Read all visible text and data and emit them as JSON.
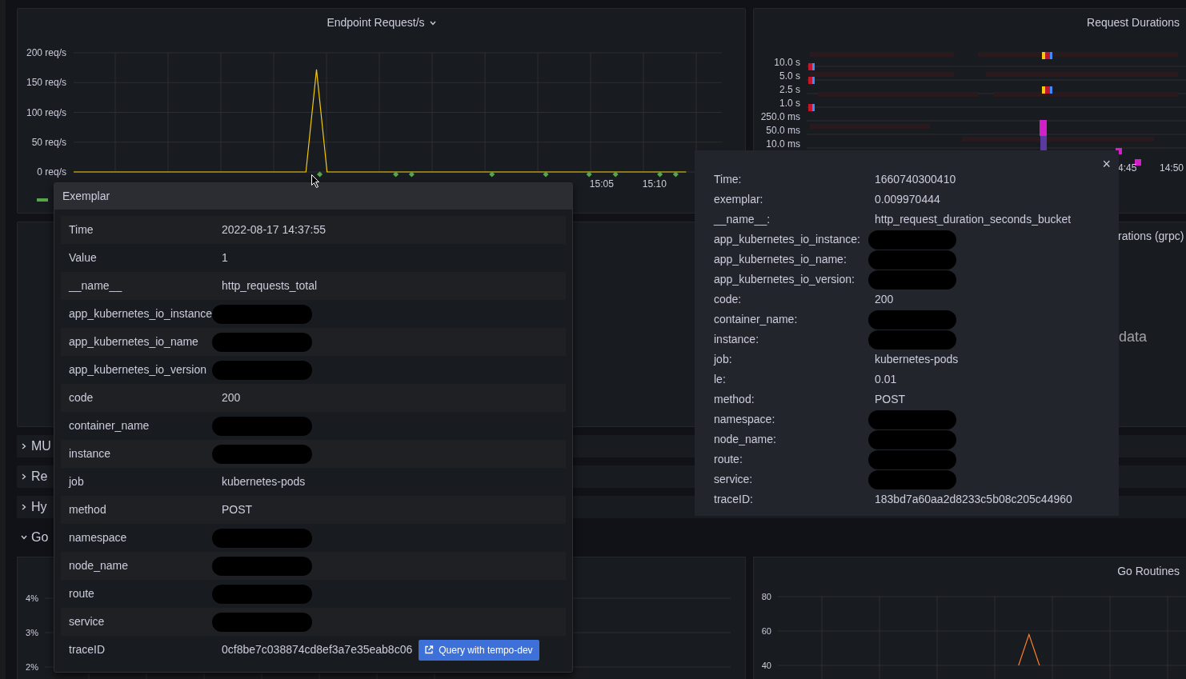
{
  "panels": [
    {
      "kind": "timeseries",
      "title": "Endpoint Request/s",
      "has_menu": true,
      "chart_data": {
        "type": "line",
        "categories": [
          null,
          null,
          null,
          null,
          null,
          null,
          null,
          null,
          null,
          null,
          null,
          null,
          null,
          null,
          null,
          null,
          null,
          null,
          null,
          null,
          null,
          null,
          null,
          null,
          null,
          null,
          null,
          null,
          null,
          null,
          null,
          null,
          null,
          null,
          null,
          null,
          null,
          null,
          null,
          null,
          null,
          null,
          null,
          null,
          null,
          null,
          null,
          null,
          null,
          null,
          "15:05",
          null,
          null,
          null,
          null,
          "15:10",
          null,
          null,
          null,
          null,
          null,
          null
        ],
        "series": [
          {
            "color": "#f2cc0c",
            "values": [
              0,
              0,
              0,
              0,
              0,
              0,
              0,
              0,
              0,
              0,
              0,
              0,
              0,
              0,
              0,
              0,
              0,
              0,
              0,
              0,
              0,
              0,
              0,
              172,
              0,
              0,
              0,
              0,
              0,
              0,
              0,
              0,
              0,
              0,
              0,
              0,
              0,
              0,
              0,
              0,
              0,
              0,
              0,
              0,
              0,
              0,
              0,
              0,
              0,
              0,
              0,
              0,
              0,
              0,
              0,
              0,
              0,
              0,
              0,
              null,
              null,
              null
            ]
          }
        ],
        "grid": true,
        "ylim": [
          0,
          200
        ],
        "yticks": [
          {
            "value": 0,
            "label": "0 req/s"
          },
          {
            "value": 50,
            "label": "50 req/s"
          },
          {
            "value": 100,
            "label": "100 req/s"
          },
          {
            "value": 150,
            "label": "150 req/s"
          },
          {
            "value": 200,
            "label": "200 req/s"
          }
        ]
      }
    },
    {
      "kind": "heatmap",
      "title": "Request Durations",
      "y_labels": [
        "10.0 s",
        "5.0 s",
        "2.5 s",
        "1.0 s",
        "250.0 ms",
        "50.0 ms",
        "10.0 ms"
      ],
      "x_labels": [
        "4:45",
        "14:50"
      ]
    },
    {
      "kind": "empty"
    },
    {
      "kind": "nodata",
      "title": "rations (grpc)",
      "message": "data"
    }
  ],
  "rows": [
    {
      "title": "MU",
      "expanded": false
    },
    {
      "title": "Re",
      "expanded": false
    },
    {
      "title": "Hy",
      "expanded": false
    },
    {
      "title": "Go",
      "expanded": true
    }
  ],
  "bottom_panels": [
    {
      "y_labels": [
        "4%",
        "3%",
        "2%"
      ]
    },
    {
      "title": "Go Routines",
      "chart_data": {
        "type": "line",
        "categories": [
          null,
          null,
          null,
          null,
          null,
          null,
          null,
          null,
          null,
          null,
          null,
          null,
          null,
          null,
          null,
          null,
          null,
          null,
          null,
          null,
          null,
          null,
          null,
          null,
          null,
          null,
          null,
          null,
          null,
          null,
          null,
          null,
          null,
          null,
          null,
          null,
          null,
          null,
          null,
          null
        ],
        "series": [
          {
            "color": "#ff7f2a",
            "values": [
              null,
              null,
              null,
              null,
              null,
              null,
              null,
              null,
              null,
              null,
              null,
              null,
              null,
              null,
              null,
              null,
              null,
              null,
              null,
              null,
              null,
              null,
              null,
              40,
              58,
              40,
              null,
              null,
              null,
              null,
              null,
              null,
              null,
              null,
              null,
              null,
              null,
              null,
              null,
              null
            ]
          }
        ],
        "grid": true,
        "ylim": [
          40,
          80
        ],
        "yticks": [
          {
            "value": 80,
            "label": "80"
          },
          {
            "value": 60,
            "label": "60"
          },
          {
            "value": 40,
            "label": "40"
          }
        ]
      }
    }
  ],
  "exemplar": {
    "title": "Exemplar",
    "fields": [
      {
        "label": "Time",
        "value": "2022-08-17 14:37:55"
      },
      {
        "label": "Value",
        "value": "1"
      },
      {
        "label": "__name__",
        "value": "http_requests_total"
      },
      {
        "label": "app_kubernetes_io_instance",
        "redacted": true
      },
      {
        "label": "app_kubernetes_io_name",
        "redacted": true
      },
      {
        "label": "app_kubernetes_io_version",
        "redacted": true
      },
      {
        "label": "code",
        "value": "200"
      },
      {
        "label": "container_name",
        "redacted": true
      },
      {
        "label": "instance",
        "redacted": true
      },
      {
        "label": "job",
        "value": "kubernetes-pods"
      },
      {
        "label": "method",
        "value": "POST"
      },
      {
        "label": "namespace",
        "redacted": true
      },
      {
        "label": "node_name",
        "redacted": true
      },
      {
        "label": "route",
        "redacted": true
      },
      {
        "label": "service",
        "redacted": true
      },
      {
        "label": "traceID",
        "value": "0cf8be7c038874cd8ef3a7e35eab8c06",
        "link": "Query with tempo-dev"
      }
    ]
  },
  "heatmap_tooltip": {
    "close": "×",
    "fields": [
      {
        "label": "Time:",
        "value": "1660740300410"
      },
      {
        "label": "exemplar:",
        "value": "0.009970444"
      },
      {
        "label": "__name__:",
        "value": "http_request_duration_seconds_bucket"
      },
      {
        "label": "app_kubernetes_io_instance:",
        "redacted": true
      },
      {
        "label": "app_kubernetes_io_name:",
        "redacted": true
      },
      {
        "label": "app_kubernetes_io_version:",
        "redacted": true
      },
      {
        "label": "code:",
        "value": "200"
      },
      {
        "label": "container_name:",
        "redacted": true
      },
      {
        "label": "instance:",
        "redacted": true
      },
      {
        "label": "job:",
        "value": "kubernetes-pods"
      },
      {
        "label": "le:",
        "value": "0.01"
      },
      {
        "label": "method:",
        "value": "POST"
      },
      {
        "label": "namespace:",
        "redacted": true
      },
      {
        "label": "node_name:",
        "redacted": true
      },
      {
        "label": "route:",
        "redacted": true
      },
      {
        "label": "service:",
        "redacted": true
      },
      {
        "label": "traceID:",
        "value": "183bd7a60aa2d8233c5b08c205c44960"
      }
    ]
  }
}
